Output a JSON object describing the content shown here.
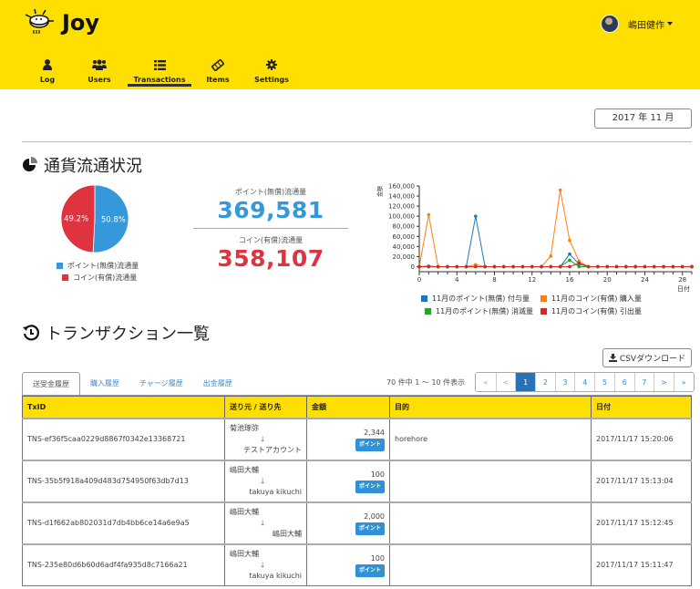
{
  "app": {
    "name": "Joy"
  },
  "user": {
    "name": "嶋田健作"
  },
  "nav": [
    {
      "label": "Log",
      "icon": "user-icon"
    },
    {
      "label": "Users",
      "icon": "users-icon"
    },
    {
      "label": "Transactions",
      "icon": "list-icon",
      "active": true
    },
    {
      "label": "Items",
      "icon": "ticket-icon"
    },
    {
      "label": "Settings",
      "icon": "gear-icon"
    }
  ],
  "period": {
    "label": "2017 年 11 月"
  },
  "circulation": {
    "title": "通貨流通状況",
    "points_label": "ポイント(無償)流通量",
    "points_value": "369,581",
    "coins_label": "コイン(有償)流通量",
    "coins_value": "358,107",
    "pie": {
      "slices": [
        {
          "name": "ポイント(無償)流通量",
          "percent": 50.8,
          "label": "50.8%",
          "color": "#3498db"
        },
        {
          "name": "コイン(有償)流通量",
          "percent": 49.2,
          "label": "49.2%",
          "color": "#e03340"
        }
      ]
    }
  },
  "chart_data": {
    "type": "line",
    "title": "",
    "xlabel": "日付",
    "ylabel": "金額",
    "xlim": [
      0,
      29
    ],
    "ylim": [
      -10000,
      160000
    ],
    "x_ticks": [
      0,
      4,
      8,
      12,
      16,
      20,
      24,
      28
    ],
    "y_ticks": [
      0,
      20000,
      40000,
      60000,
      80000,
      100000,
      120000,
      140000,
      160000
    ],
    "y_tick_labels": [
      "0",
      "20,000",
      "40,000",
      "60,000",
      "80,000",
      "100,000",
      "120,000",
      "140,000",
      "160,000"
    ],
    "x": [
      0,
      1,
      2,
      3,
      4,
      5,
      6,
      7,
      8,
      9,
      10,
      11,
      12,
      13,
      14,
      15,
      16,
      17,
      18,
      19,
      20,
      21,
      22,
      23,
      24,
      25,
      26,
      27,
      28,
      29
    ],
    "series": [
      {
        "name": "11月のポイント(無償) 付与量",
        "color": "#1f77b4",
        "values": [
          0,
          1000,
          0,
          0,
          0,
          0,
          100000,
          0,
          0,
          0,
          0,
          0,
          0,
          0,
          0,
          0,
          25000,
          5000,
          0,
          0,
          0,
          0,
          0,
          0,
          0,
          0,
          0,
          0,
          0,
          0
        ]
      },
      {
        "name": "11月のコイン(有償) 購入量",
        "color": "#ff7f0e",
        "values": [
          0,
          103000,
          0,
          0,
          0,
          0,
          4000,
          0,
          0,
          0,
          0,
          0,
          0,
          0,
          21000,
          152000,
          52000,
          11000,
          0,
          0,
          0,
          0,
          0,
          0,
          0,
          0,
          0,
          0,
          0,
          0
        ]
      },
      {
        "name": "11月のポイント(無償) 消滅量",
        "color": "#2ca02c",
        "values": [
          0,
          0,
          0,
          0,
          0,
          0,
          0,
          0,
          0,
          0,
          0,
          0,
          0,
          0,
          0,
          0,
          13000,
          0,
          0,
          0,
          0,
          0,
          0,
          0,
          0,
          0,
          0,
          0,
          0,
          0
        ]
      },
      {
        "name": "11月のコイン(有償) 引出量",
        "color": "#d62728",
        "values": [
          0,
          0,
          0,
          0,
          0,
          0,
          0,
          0,
          0,
          0,
          0,
          0,
          0,
          0,
          0,
          0,
          0,
          7000,
          0,
          0,
          0,
          0,
          0,
          0,
          0,
          0,
          0,
          0,
          0,
          0
        ]
      }
    ],
    "legend": "bottom"
  },
  "transactions": {
    "title": "トランザクション一覧",
    "csv_label": "CSVダウンロード",
    "tabs": [
      "送受金履歴",
      "購入履歴",
      "チャージ履歴",
      "出金履歴"
    ],
    "count_text": "70 件中 1 ～ 10 件表示",
    "pager": [
      "«",
      "<",
      "1",
      "2",
      "3",
      "4",
      "5",
      "6",
      "7",
      ">",
      "»"
    ],
    "current_page": "1",
    "columns": [
      "TxID",
      "送り元 / 送り先",
      "金額",
      "目的",
      "日付"
    ],
    "rows": [
      {
        "txid": "TNS-ef36f5caa0229d8867f0342e13368721",
        "from": "菊池琢弥",
        "to": "テストアカウント",
        "amount": "2,344",
        "type": "ポイント",
        "purpose": "horehore",
        "date": "2017/11/17 15:20:06"
      },
      {
        "txid": "TNS-35b5f918a409d483d754950f63db7d13",
        "from": "嶋田大輔",
        "to": "takuya kikuchi",
        "amount": "100",
        "type": "ポイント",
        "purpose": "",
        "date": "2017/11/17 15:13:04"
      },
      {
        "txid": "TNS-d1f662ab802031d7db4bb6ce14a6e9a5",
        "from": "嶋田大輔",
        "to": "嶋田大輔",
        "amount": "2,000",
        "type": "ポイント",
        "purpose": "",
        "date": "2017/11/17 15:12:45"
      },
      {
        "txid": "TNS-235e80d6b60d6adf4fa935d8c7166a21",
        "from": "嶋田大輔",
        "to": "takuya kikuchi",
        "amount": "100",
        "type": "ポイント",
        "purpose": "",
        "date": "2017/11/17 15:11:47"
      }
    ]
  }
}
